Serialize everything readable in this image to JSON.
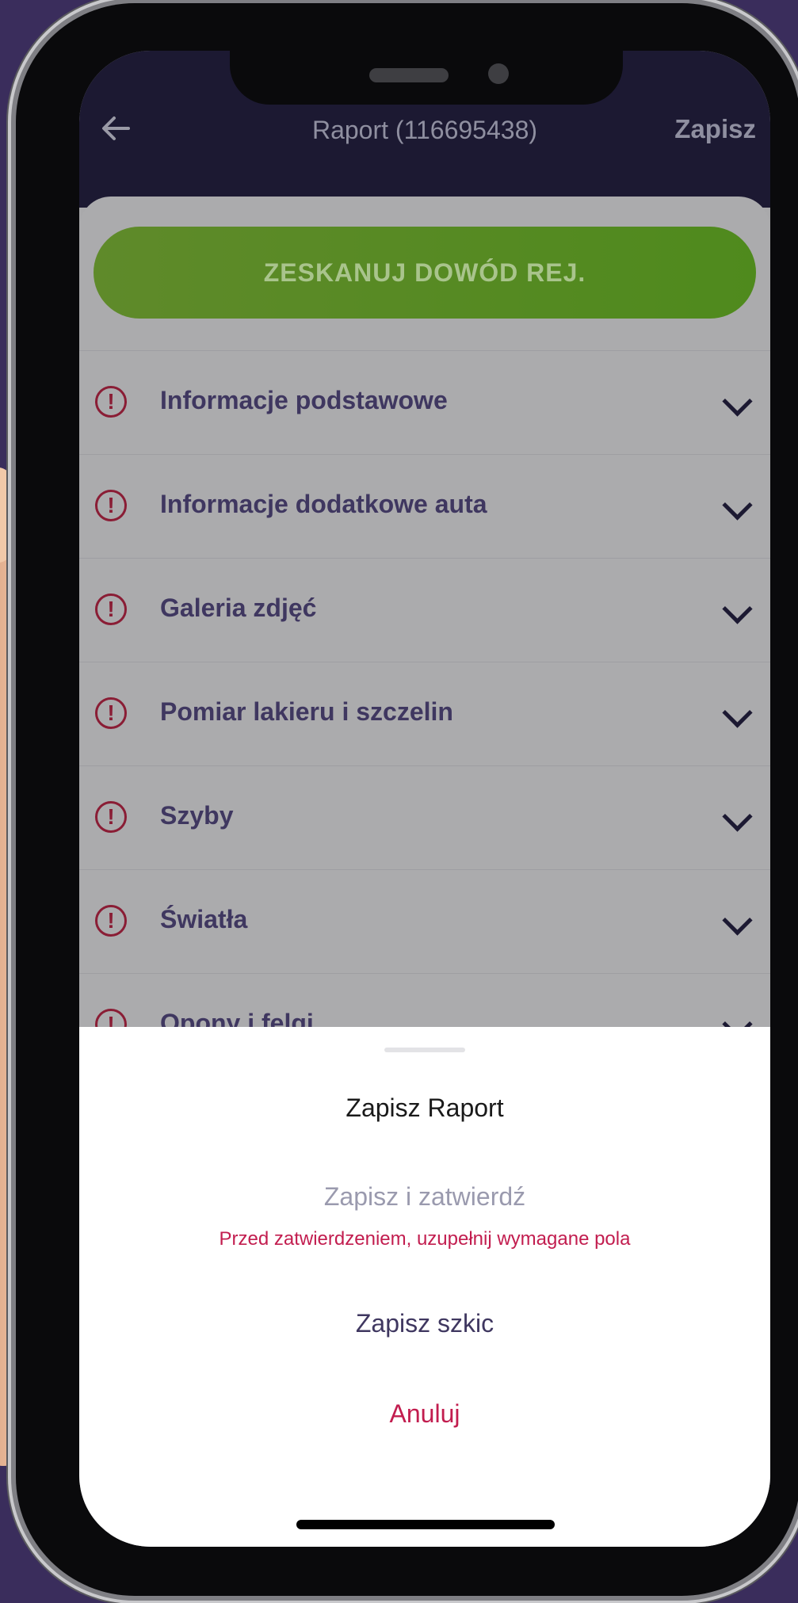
{
  "appbar": {
    "title": "Raport (116695438)",
    "save_label": "Zapisz"
  },
  "scan_button": {
    "label": "ZESKANUJ DOWÓD REJ."
  },
  "sections": [
    {
      "label": "Informacje podstawowe"
    },
    {
      "label": "Informacje dodatkowe auta"
    },
    {
      "label": "Galeria zdjęć"
    },
    {
      "label": "Pomiar lakieru i szczelin"
    },
    {
      "label": "Szyby"
    },
    {
      "label": "Światła"
    },
    {
      "label": "Opony i felgi"
    }
  ],
  "warning_glyph": "!",
  "sheet": {
    "title": "Zapisz Raport",
    "confirm_label": "Zapisz i zatwierdź",
    "warning_text": "Przed zatwierdzeniem, uzupełnij wymagane pola",
    "draft_label": "Zapisz szkic",
    "cancel_label": "Anuluj"
  },
  "colors": {
    "background": "#3a2d5c",
    "appbar": "#1c1932",
    "scan_button": "#4f8a1d",
    "warning": "#8a1d35",
    "cancel": "#c21d4f"
  },
  "icons": {
    "back": "arrow-left-icon",
    "section_status": "warning-circle-icon",
    "section_toggle": "chevron-down-icon"
  }
}
